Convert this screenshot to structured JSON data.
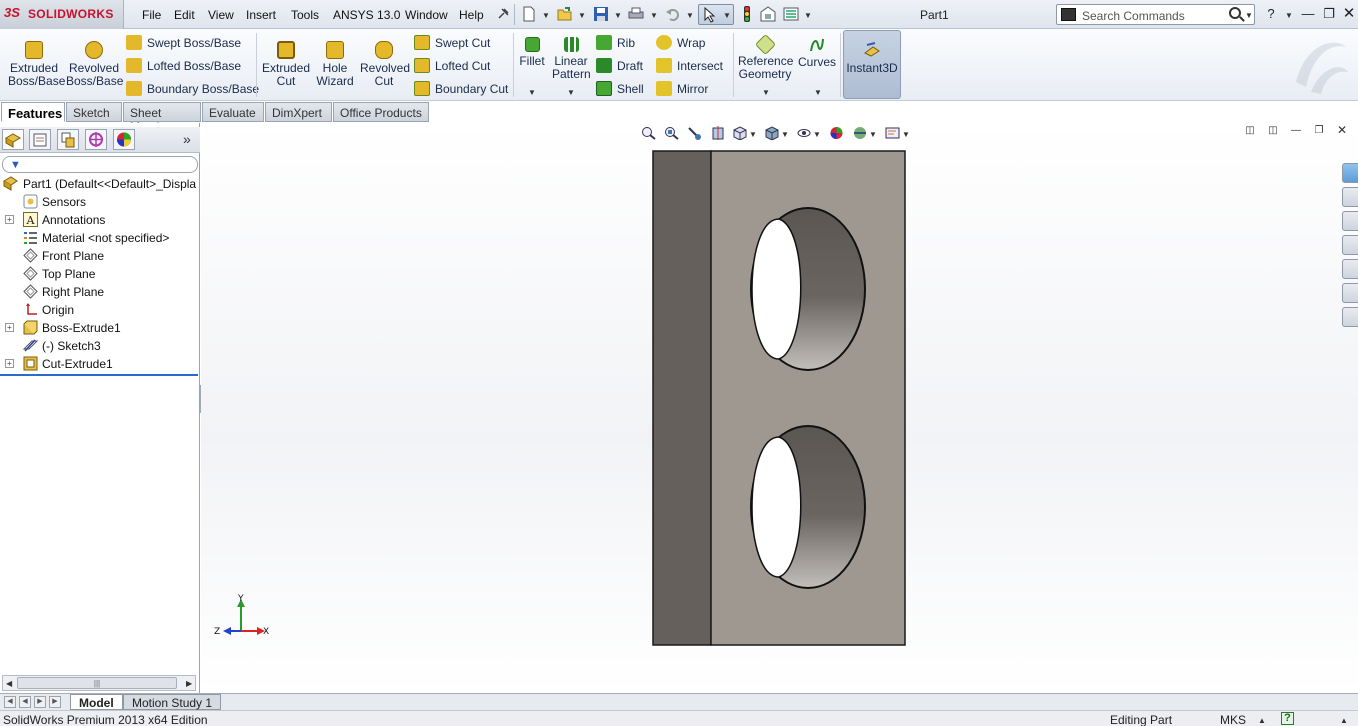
{
  "app": {
    "logo_ds": "3S",
    "logo_name": "SOLIDWORKS",
    "document_title": "Part1"
  },
  "menu": [
    "File",
    "Edit",
    "View",
    "Insert",
    "Tools",
    "ANSYS 13.0",
    "Window",
    "Help"
  ],
  "search": {
    "placeholder": "Search Commands"
  },
  "commands": {
    "extruded_boss": "Extruded\nBoss/Base",
    "revolved_boss": "Revolved\nBoss/Base",
    "swept_boss": "Swept Boss/Base",
    "lofted_boss": "Lofted Boss/Base",
    "boundary_boss": "Boundary Boss/Base",
    "extruded_cut": "Extruded\nCut",
    "hole_wizard": "Hole\nWizard",
    "revolved_cut": "Revolved\nCut",
    "swept_cut": "Swept Cut",
    "lofted_cut": "Lofted Cut",
    "boundary_cut": "Boundary Cut",
    "fillet": "Fillet",
    "linear_pattern": "Linear\nPattern",
    "rib": "Rib",
    "draft": "Draft",
    "shell": "Shell",
    "wrap": "Wrap",
    "intersect": "Intersect",
    "mirror": "Mirror",
    "reference_geometry": "Reference\nGeometry",
    "curves": "Curves",
    "instant3d": "Instant3D"
  },
  "tabs": [
    "Features",
    "Sketch",
    "Sheet Metal",
    "Evaluate",
    "DimXpert",
    "Office Products"
  ],
  "tree": {
    "root": "Part1  (Default<<Default>_Displa",
    "items": [
      "Sensors",
      "Annotations",
      "Material <not specified>",
      "Front Plane",
      "Top Plane",
      "Right Plane",
      "Origin",
      "Boss-Extrude1",
      "(-) Sketch3",
      "Cut-Extrude1"
    ]
  },
  "triad": {
    "y": "Y",
    "z": "Z",
    "x": "X"
  },
  "bottom_tabs": [
    "Model",
    "Motion Study 1"
  ],
  "status": {
    "edition": "SolidWorks Premium 2013 x64 Edition",
    "mode": "Editing Part",
    "units": "MKS",
    "help": "?"
  },
  "colors": {
    "accent": "#c8102e",
    "part_face": "#9f9890",
    "part_side": "#65605c",
    "hole_shadow": "#5f5b57"
  }
}
